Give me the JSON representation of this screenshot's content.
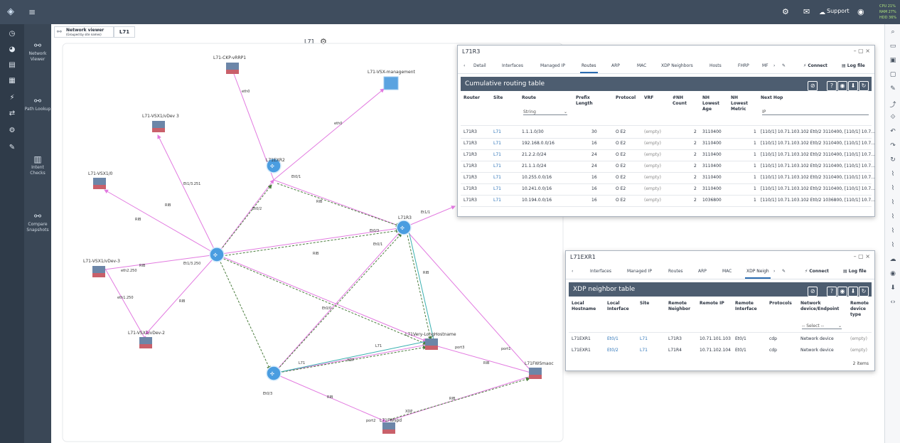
{
  "top_bar": {
    "logo_icon": "app-logo-icon",
    "menu_icon": "hamburger-menu-icon",
    "support_label": "Support",
    "stats": [
      "CPU 21%",
      "RAM 27%",
      "HDD 36%"
    ],
    "stats_color": "#aee37c"
  },
  "left_nav": {
    "icons": [
      "clock-icon",
      "dashboard-icon",
      "reports-icon",
      "tables-icon",
      "diagrams-icon",
      "filter-icon",
      "settings-icon",
      "tools-icon"
    ]
  },
  "sub_nav": {
    "items": [
      {
        "label": "Network Viewer",
        "icon": "network-viewer-icon"
      },
      {
        "label": "Path Lookup",
        "icon": "path-lookup-icon"
      },
      {
        "label": "Intent Checks",
        "icon": "intent-checks-icon"
      },
      {
        "label": "Compare Snapshots",
        "icon": "compare-snapshots-icon"
      }
    ]
  },
  "right_bar": {
    "icons": [
      "search-icon",
      "folder-icon",
      "save-icon",
      "save-as-icon",
      "edit-icon",
      "export-icon",
      "fit-icon",
      "undo-icon",
      "redo-icon",
      "refresh-icon",
      "layout1-icon",
      "layout2-icon",
      "layout3-icon",
      "layout4-icon",
      "layout5-icon",
      "layout6-icon",
      "cloud-icon",
      "eye-icon",
      "download-icon",
      "code-icon"
    ]
  },
  "viewer_tabs": {
    "tab1_title": "Network viewer",
    "tab1_subtitle": "(Grouped by site names)",
    "tab2_title": "L71"
  },
  "site_title": "L71",
  "graph": {
    "nodes": [
      {
        "id": "vrrp",
        "label": "L71-CKP-vRRP1",
        "type": "firewall"
      },
      {
        "id": "vsxmgmt",
        "label": "L71-VSX-management",
        "type": "server"
      },
      {
        "id": "vsx1vdev3",
        "label": "L71-VSX1/vDev 3",
        "type": "firewall"
      },
      {
        "id": "vsx1_0",
        "label": "L71-VSX1/0",
        "type": "firewall"
      },
      {
        "id": "vsx1vdev3b",
        "label": "L71-VSX1/vDev-3",
        "type": "firewall"
      },
      {
        "id": "vsx1vdev2",
        "label": "L71-VSX1/vDev-2",
        "type": "firewall"
      },
      {
        "id": "exr2",
        "label": "L71EXR2",
        "type": "router"
      },
      {
        "id": "r3",
        "label": "L71R3",
        "type": "router"
      },
      {
        "id": "hub",
        "label": "",
        "type": "router"
      },
      {
        "id": "r4",
        "label": "",
        "type": "router"
      },
      {
        "id": "longhost",
        "label": "L71Very-LongHostname",
        "type": "firewall"
      },
      {
        "id": "fwsmaoc",
        "label": "L71FWSmaoc",
        "type": "firewall"
      },
      {
        "id": "fwbot",
        "label": "L71FWspd",
        "type": "firewall"
      }
    ]
  },
  "routing_panel": {
    "window_title": "L71R3",
    "tabs": [
      "Detail",
      "Interfaces",
      "Managed IP",
      "Routes",
      "ARP",
      "MAC",
      "XDP Neighbors",
      "Hosts",
      "FHRP",
      "MF"
    ],
    "active_tab": "Routes",
    "connect_label": "Connect",
    "logfile_label": "Log file",
    "table_title": "Cumulative routing table",
    "columns": [
      "Router",
      "Site",
      "Route",
      "Prefix Length",
      "Protocol",
      "VRF",
      "#NH Count",
      "NH Lowest Age",
      "NH Lowest Metric",
      "Next Hop"
    ],
    "route_filter_type": "String",
    "nexthop_filter_type": "IP",
    "rows": [
      [
        "L71R3",
        "L71",
        "1.1.1.0/30",
        "30",
        "O E2",
        "(empty)",
        "2",
        "3110400",
        "1",
        "[110/1] 10.71.103.102 Et0/2 3110400, [110/1] 10.7..."
      ],
      [
        "L71R3",
        "L71",
        "192.168.0.0/16",
        "16",
        "O E2",
        "(empty)",
        "2",
        "3110400",
        "1",
        "[110/1] 10.71.103.102 Et0/2 3110400, [110/1] 10.7..."
      ],
      [
        "L71R3",
        "L71",
        "21.2.2.0/24",
        "24",
        "O E2",
        "(empty)",
        "2",
        "3110400",
        "1",
        "[110/1] 10.71.103.102 Et0/2 3110400, [110/1] 10.7..."
      ],
      [
        "L71R3",
        "L71",
        "21.1.1.0/24",
        "24",
        "O E2",
        "(empty)",
        "2",
        "3110400",
        "1",
        "[110/1] 10.71.103.102 Et0/2 3110400, [110/1] 10.7..."
      ],
      [
        "L71R3",
        "L71",
        "10.255.0.0/16",
        "16",
        "O E2",
        "(empty)",
        "2",
        "3110400",
        "1",
        "[110/1] 10.71.103.102 Et0/2 3110400, [110/1] 10.7..."
      ],
      [
        "L71R3",
        "L71",
        "10.241.0.0/16",
        "16",
        "O E2",
        "(empty)",
        "2",
        "3110400",
        "1",
        "[110/1] 10.71.103.102 Et0/2 3110400, [110/1] 10.7..."
      ],
      [
        "L71R3",
        "L71",
        "10.194.0.0/16",
        "16",
        "O E2",
        "(empty)",
        "2",
        "1036800",
        "1",
        "[110/1] 10.71.103.102 Et0/2 1036800, [110/1] 10.7..."
      ]
    ]
  },
  "xdp_panel": {
    "window_title": "L71EXR1",
    "tabs": [
      "Interfaces",
      "Managed IP",
      "Routes",
      "ARP",
      "MAC",
      "XDP Neigh"
    ],
    "active_tab": "XDP Neigh",
    "connect_label": "Connect",
    "logfile_label": "Log file",
    "table_title": "XDP neighbor table",
    "columns": [
      "Local Hostname",
      "Local Interface",
      "Site",
      "Remote Neighbor",
      "Remote IP",
      "Remote Interface",
      "Protocols",
      "Network device/Endpoint",
      "Remote device type"
    ],
    "select_placeholder": "-- Select --",
    "rows": [
      [
        "L71EXR1",
        "Et0/1",
        "L71",
        "L71R3",
        "10.71.101.103",
        "Et0/1",
        "cdp",
        "Network device",
        "(empty)"
      ],
      [
        "L71EXR1",
        "Et0/2",
        "L71",
        "L71R4",
        "10.71.102.104",
        "Et0/1",
        "cdp",
        "Network device",
        "(empty)"
      ]
    ],
    "items_count": "2 items"
  },
  "colors": {
    "topbar": "#3f4d5e",
    "leftnav": "#2f3b49",
    "router": "#4a9de0",
    "firewall": "#6c86a8",
    "ospf_edge": "#e27ae0",
    "xdp_edge": "#4b7d3e",
    "table_header": "#4d5d70"
  }
}
